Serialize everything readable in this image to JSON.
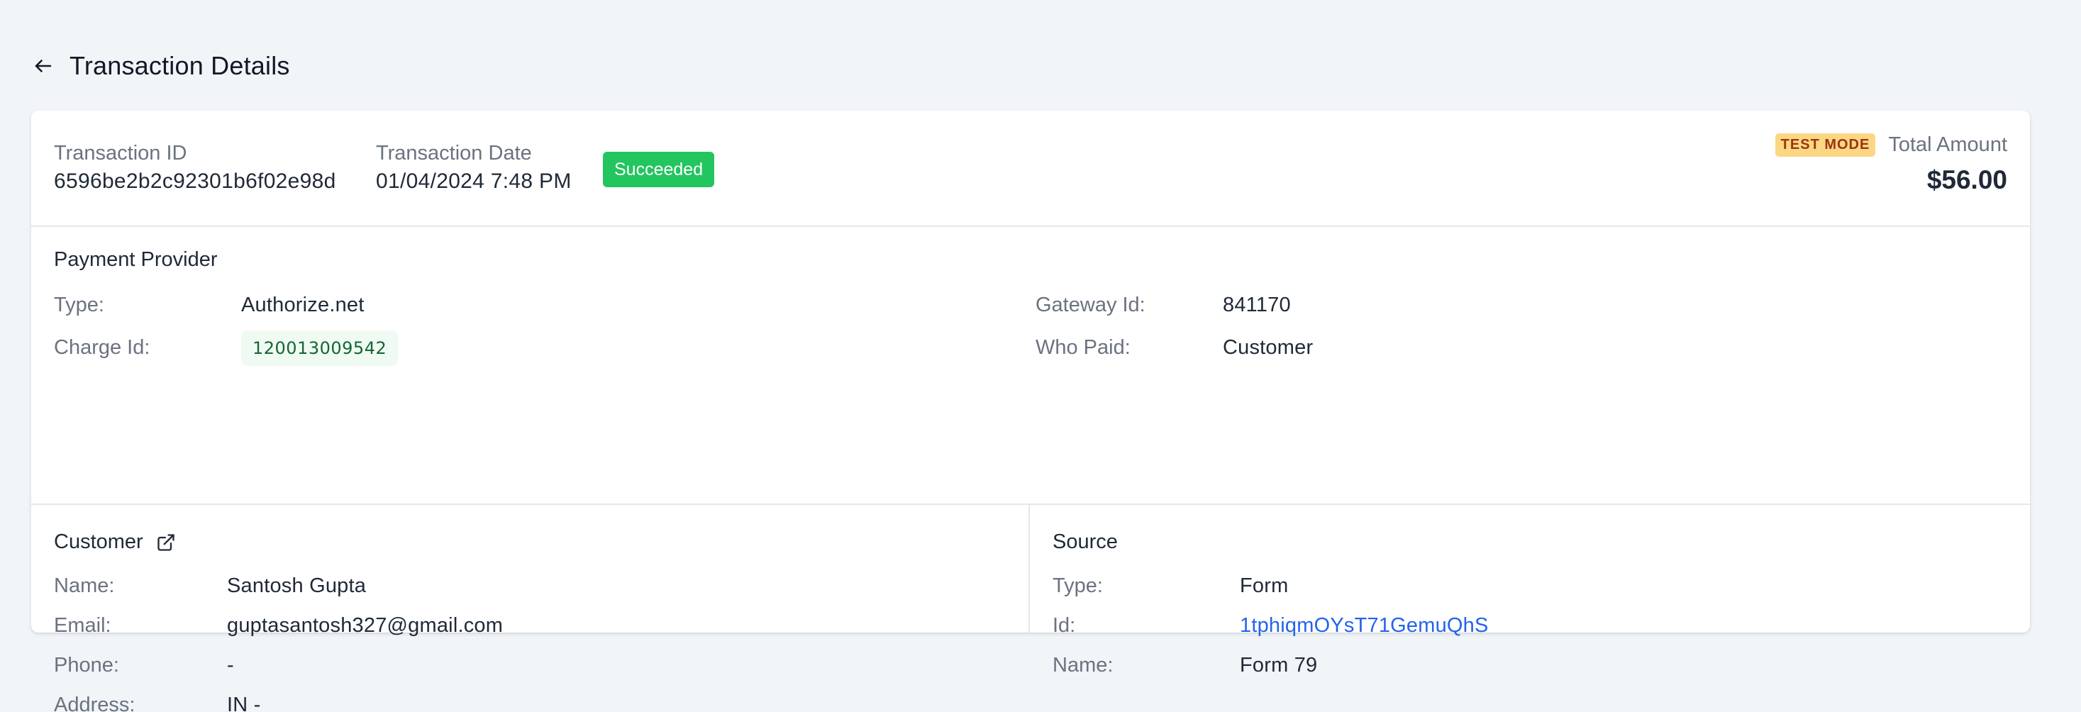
{
  "header": {
    "title": "Transaction Details",
    "back_icon": "arrow-left-icon"
  },
  "summary": {
    "transaction_id_label": "Transaction ID",
    "transaction_id": "6596be2b2c92301b6f02e98d",
    "transaction_date_label": "Transaction Date",
    "transaction_date": "01/04/2024 7:48 PM",
    "status": "Succeeded",
    "status_color": "#22c55e",
    "mode_badge": "TEST MODE",
    "total_label": "Total Amount",
    "total_value": "$56.00"
  },
  "provider": {
    "heading": "Payment Provider",
    "type_label": "Type:",
    "type": "Authorize.net",
    "charge_label": "Charge Id:",
    "charge_id": "120013009542",
    "gateway_label": "Gateway Id:",
    "gateway_id": "841170",
    "who_label": "Who Paid:",
    "who_paid": "Customer"
  },
  "customer": {
    "heading": "Customer",
    "external_icon": "external-link-icon",
    "name_label": "Name:",
    "name": "Santosh Gupta",
    "email_label": "Email:",
    "email": "guptasantosh327@gmail.com",
    "phone_label": "Phone:",
    "phone": "-",
    "address_label": "Address:",
    "address": "IN -"
  },
  "source": {
    "heading": "Source",
    "type_label": "Type:",
    "type": "Form",
    "id_label": "Id:",
    "id": "1tphiqmOYsT71GemuQhS",
    "name_label": "Name:",
    "name": "Form 79",
    "link_color": "#2563eb"
  }
}
